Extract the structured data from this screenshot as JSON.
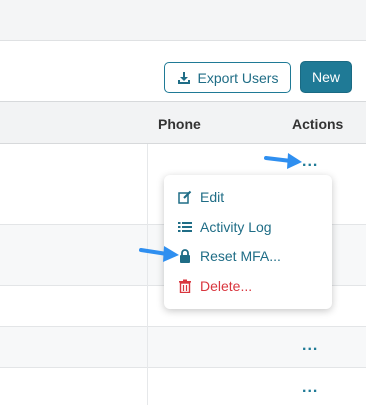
{
  "toolbar": {
    "export_label": "Export Users",
    "new_label": "New"
  },
  "table": {
    "columns": [
      "Phone",
      "Actions"
    ],
    "row_action_label": "..."
  },
  "menu": {
    "items": [
      {
        "label": "Edit",
        "icon": "edit-icon"
      },
      {
        "label": "Activity Log",
        "icon": "list-icon"
      },
      {
        "label": "Reset MFA...",
        "icon": "lock-icon"
      },
      {
        "label": "Delete...",
        "icon": "trash-icon"
      }
    ]
  },
  "colors": {
    "primary": "#1f7a96",
    "danger": "#d9363e",
    "annotation_arrow": "#2f8ff0"
  }
}
